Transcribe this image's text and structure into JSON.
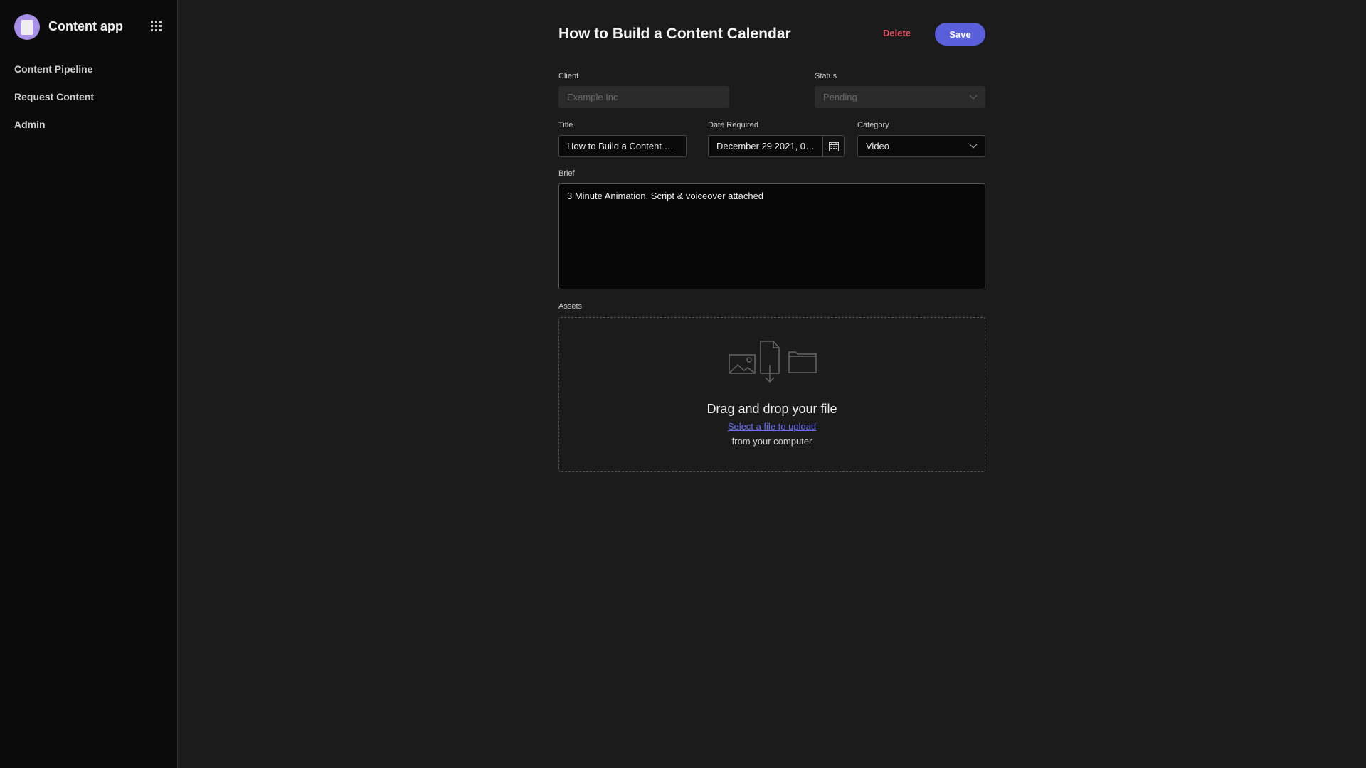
{
  "sidebar": {
    "app_title": "Content app",
    "items": [
      {
        "label": "Content Pipeline"
      },
      {
        "label": "Request Content"
      },
      {
        "label": "Admin"
      }
    ]
  },
  "header": {
    "title": "How to Build a Content Calendar",
    "delete_label": "Delete",
    "save_label": "Save"
  },
  "form": {
    "client": {
      "label": "Client",
      "placeholder": "Example Inc"
    },
    "status": {
      "label": "Status",
      "value": "Pending"
    },
    "title": {
      "label": "Title",
      "value": "How to Build a Content …"
    },
    "date": {
      "label": "Date Required",
      "value": "December 29 2021, 0…"
    },
    "category": {
      "label": "Category",
      "value": "Video"
    },
    "brief": {
      "label": "Brief",
      "value": "3 Minute Animation. Script & voiceover attached"
    },
    "assets": {
      "label": "Assets",
      "drop_title": "Drag and drop your file",
      "select_link": "Select a file to upload",
      "from_text": "from your computer"
    }
  },
  "colors": {
    "accent": "#5a5fdc",
    "danger": "#e5566a",
    "sidebar_bg": "#0b0b0b",
    "main_bg": "#1b1b1b"
  }
}
